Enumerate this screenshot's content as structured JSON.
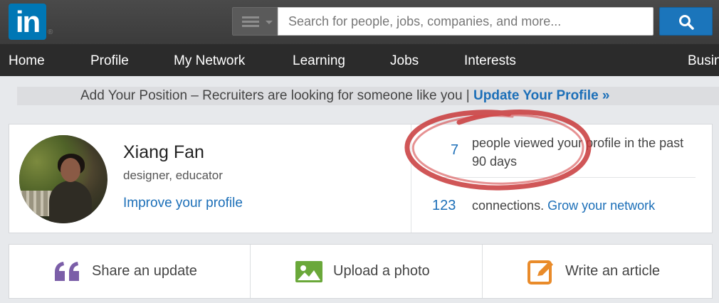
{
  "header": {
    "logo_text": "in",
    "registered_mark": "®",
    "search_placeholder": "Search for people, jobs, companies, and more...",
    "search_button_icon": "magnifier-icon"
  },
  "nav": {
    "items": [
      {
        "label": "Home"
      },
      {
        "label": "Profile"
      },
      {
        "label": "My Network"
      },
      {
        "label": "Learning"
      },
      {
        "label": "Jobs"
      },
      {
        "label": "Interests"
      },
      {
        "label": "Busin"
      }
    ]
  },
  "banner": {
    "text": "Add Your Position – Recruiters are looking for someone like you  |  ",
    "link": "Update Your Profile »"
  },
  "profile": {
    "name": "Xiang Fan",
    "headline": "designer, educator",
    "improve_link": "Improve your profile",
    "views_count": "7",
    "views_text": "people viewed your profile in the past 90 days",
    "connections_count": "123",
    "connections_text": "connections. ",
    "grow_link": "Grow your network"
  },
  "share": {
    "update_label": "Share an update",
    "photo_label": "Upload a photo",
    "article_label": "Write an article"
  },
  "colors": {
    "brand_blue": "#0077b5",
    "link_blue": "#1c6fb8",
    "annotation_red": "#c8383a",
    "quote_purple": "#7b5ea8",
    "photo_green": "#6aa83a",
    "article_orange": "#e98b2a"
  },
  "more_dots": "..."
}
